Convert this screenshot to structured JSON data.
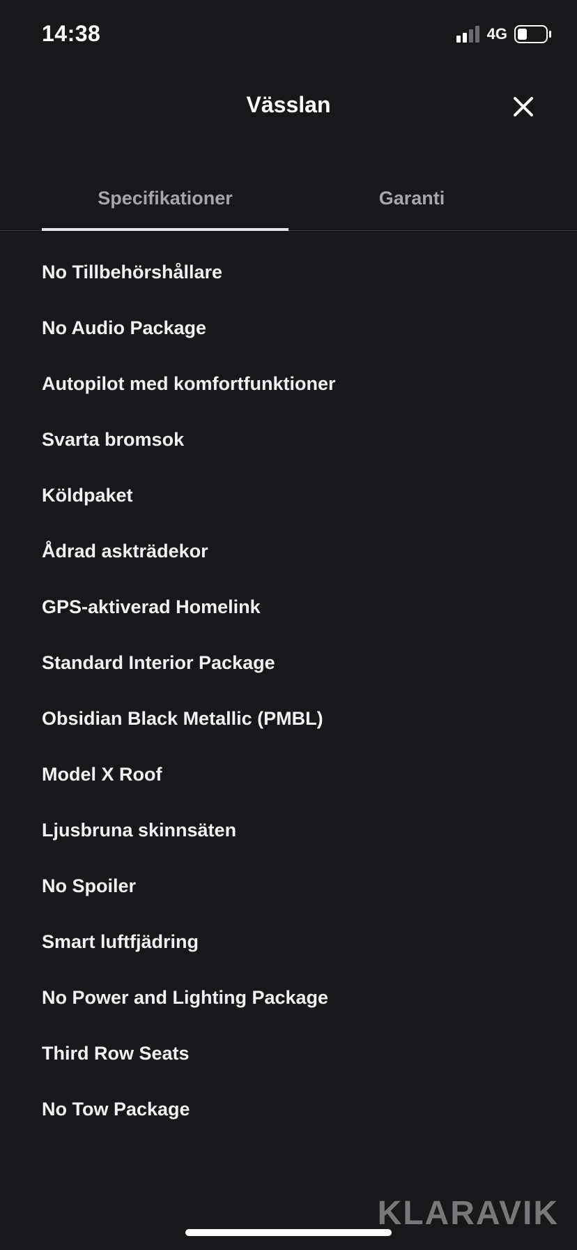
{
  "status_bar": {
    "time": "14:38",
    "network": "4G",
    "battery_level": 0.35,
    "icons": [
      "signal-icon",
      "battery-icon"
    ]
  },
  "header": {
    "title": "Vässlan",
    "close_icon": "close-icon"
  },
  "tabs": [
    {
      "label": "Specifikationer",
      "active": true
    },
    {
      "label": "Garanti",
      "active": false
    }
  ],
  "specifications": [
    "No Tillbehörshållare",
    "No Audio Package",
    "Autopilot med komfortfunktioner",
    "Svarta bromsok",
    "Köldpaket",
    "Ådrad askträdekor",
    "GPS-aktiverad Homelink",
    "Standard Interior Package",
    "Obsidian Black Metallic (PMBL)",
    "Model X Roof",
    "Ljusbruna skinnsäten",
    "No Spoiler",
    "Smart luftfjädring",
    "No Power and Lighting Package",
    "Third Row Seats",
    "No Tow Package"
  ],
  "watermark": "KLARAVIK",
  "colors": {
    "background": "#18181a",
    "text": "#f2f2f4",
    "tab_inactive": "#a6a6aa",
    "underline": "#e6e6e8"
  }
}
